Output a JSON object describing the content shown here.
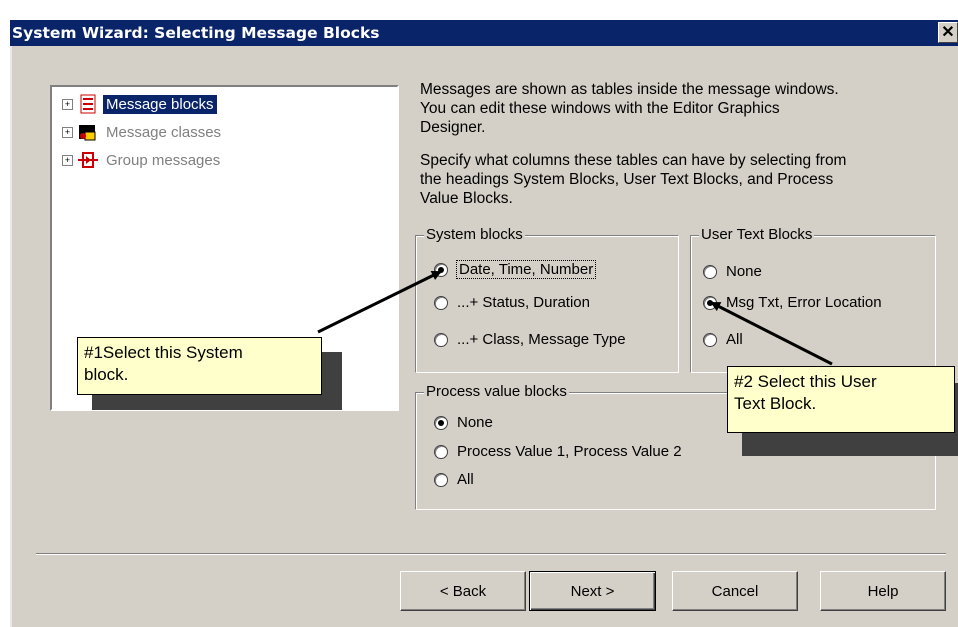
{
  "window": {
    "title": "System Wizard: Selecting Message Blocks",
    "close_glyph": "✕"
  },
  "tree": {
    "items": [
      {
        "label": "Message blocks",
        "icon": "message-blocks-icon",
        "selected": true
      },
      {
        "label": "Message classes",
        "icon": "message-classes-icon",
        "selected": false
      },
      {
        "label": "Group messages",
        "icon": "group-messages-icon",
        "selected": false
      }
    ]
  },
  "description": {
    "para1": [
      "Messages are shown as tables inside the message windows.",
      "You can edit these windows with the Editor Graphics",
      "Designer."
    ],
    "para2": [
      "Specify what columns these tables can have by selecting from",
      "the headings System Blocks, User Text Blocks, and Process",
      "Value Blocks."
    ]
  },
  "system_blocks": {
    "legend": "System blocks",
    "options": [
      "Date, Time, Number",
      "...+ Status, Duration",
      "...+ Class, Message Type"
    ],
    "selected_index": 0
  },
  "user_text_blocks": {
    "legend": "User Text Blocks",
    "options": [
      "None",
      "Msg Txt, Error Location",
      "All"
    ],
    "selected_index": 1
  },
  "process_value_blocks": {
    "legend": "Process value blocks",
    "options": [
      "None",
      "Process Value 1, Process Value 2",
      "All"
    ],
    "selected_index": 0
  },
  "callouts": {
    "first": [
      "#1Select this System",
      "block."
    ],
    "second": [
      "#2 Select this User",
      "Text Block."
    ]
  },
  "buttons": {
    "back": "< Back",
    "next": "Next >",
    "cancel": "Cancel",
    "help": "Help"
  },
  "colors": {
    "titlebar": "#0a246a",
    "dialog_bg": "#d4d0c8",
    "callout_bg": "#ffffcc"
  }
}
